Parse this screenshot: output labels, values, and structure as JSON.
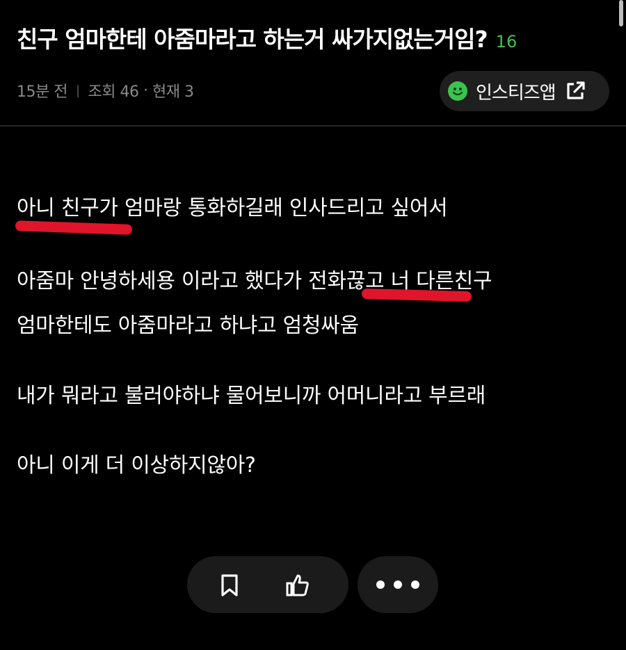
{
  "post": {
    "title": "친구 엄마한테 아줌마라고 하는거 싸가지없는거임?",
    "comment_count": "16",
    "time": "15분 전",
    "views": "조회 46",
    "current": "현재 3"
  },
  "app_button": {
    "label": "인스티즈앱"
  },
  "body": {
    "lines": [
      "아니 친구가 엄마랑 통화하길래 인사드리고 싶어서",
      "아줌마 안녕하세용 이라고 했다가 전화끊고 너 다른친구",
      "엄마한테도 아줌마라고 하냐고 엄청싸움",
      "내가 뭐라고 불러야하냐 물어보니까 어머니라고 부르래",
      "아니 이게 더 이상하지않아?"
    ]
  },
  "colors": {
    "accent_green": "#3cc24f",
    "highlight_red": "#e0152b",
    "background": "#000000",
    "pill_bg": "#1f1f1f"
  },
  "icons": [
    "smiley-icon",
    "external-link-icon",
    "bookmark-icon",
    "thumbs-up-icon",
    "more-dots-icon"
  ]
}
